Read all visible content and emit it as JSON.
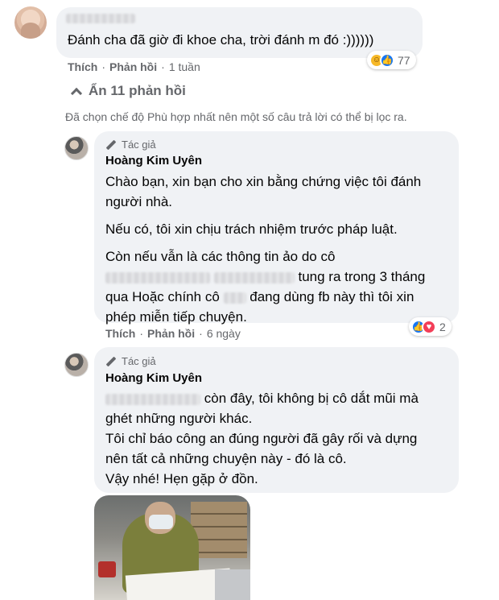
{
  "top_comment": {
    "text": "Đánh cha đã giờ đi khoe cha, trời đánh m đó :))))))",
    "like": "Thích",
    "reply": "Phản hồi",
    "time": "1 tuần",
    "reaction_count": "77",
    "reaction_icons": [
      "haha-icon",
      "like-icon"
    ]
  },
  "replies_toggle": "Ẩn 11 phản hồi",
  "filter_note": "Đã chọn chế độ Phù hợp nhất nên một số câu trả lời có thể bị lọc ra.",
  "reply_a": {
    "author_badge": "Tác giả",
    "author": "Hoàng Kim Uyên",
    "p1": "Chào bạn, xin bạn cho xin bằng chứng việc tôi đánh người nhà.",
    "p2": "Nếu có, tôi xin chịu trách nhiệm trước pháp luật.",
    "p3_a": "Còn nếu vẫn là các thông tin ảo do cô",
    "p3_b": "tung ra trong 3 tháng qua Hoặc chính",
    "p3_c": "cô",
    "p3_d": "đang dùng fb này thì tôi xin phép miễn tiếp chuyện.",
    "like": "Thích",
    "reply": "Phản hồi",
    "time": "6 ngày",
    "reaction_count": "2",
    "reaction_icons": [
      "like-icon",
      "love-icon"
    ]
  },
  "reply_b": {
    "author_badge": "Tác giả",
    "author": "Hoàng Kim Uyên",
    "l1": "còn đây, tôi không bị cô dắt mũi mà ghét những người khác.",
    "l2": "Tôi chỉ báo công an đúng người đã gây rối và dựng nên tất cả những chuyện này - đó là cô.",
    "l3": "Vậy nhé! Hẹn gặp ở đồn."
  },
  "colors": {
    "bubble": "#f0f2f5",
    "secondary_text": "#65676b",
    "like_blue": "#1877f2",
    "love_red": "#f33e58",
    "haha_yellow": "#f7b928"
  }
}
